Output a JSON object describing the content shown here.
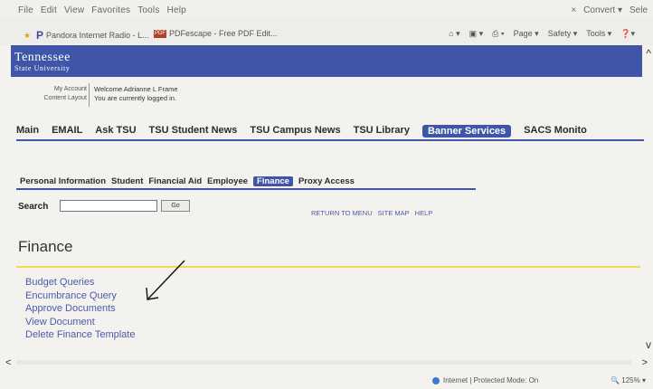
{
  "browser": {
    "menus": [
      "File",
      "Edit",
      "View",
      "Favorites",
      "Tools",
      "Help"
    ],
    "close_x": "×",
    "convert": "Convert ▾",
    "select": "Sele",
    "favorites": [
      {
        "icon": "P",
        "label": "Pandora Internet Radio - L..."
      },
      {
        "icon": "PDF",
        "label": "PDFescape - Free PDF Edit..."
      }
    ],
    "commands": [
      "Page ▾",
      "Safety ▾",
      "Tools ▾"
    ],
    "status": "Internet | Protected Mode: On",
    "zoom": "125%"
  },
  "site": {
    "logo_line1": "Tennessee",
    "logo_line2": "State University",
    "account_links": [
      "My Account",
      "Content Layout"
    ],
    "welcome_line1": "Welcome Adrianne L Frame",
    "welcome_line2": "You are currently logged in.",
    "main_tabs": [
      "Main",
      "EMAIL",
      "Ask TSU",
      "TSU Student News",
      "TSU Campus News",
      "TSU Library",
      "Banner Services",
      "SACS Monito"
    ],
    "active_main_tab": "Banner Services",
    "sub_tabs": [
      "Personal Information",
      "Student",
      "Financial Aid",
      "Employee",
      "Finance",
      "Proxy Access"
    ],
    "active_sub_tab": "Finance",
    "search_label": "Search",
    "search_value": "",
    "go_label": "Go",
    "util_links": [
      "RETURN TO MENU",
      "SITE MAP",
      "HELP"
    ]
  },
  "page": {
    "title": "Finance",
    "links": [
      "Budget Queries",
      "Encumbrance Query",
      "Approve Documents",
      "View Document",
      "Delete Finance Template"
    ]
  },
  "colors": {
    "tsu_blue": "#3e55a8",
    "link_blue": "#4a5ba8",
    "gold_rule": "#f0d94a"
  }
}
